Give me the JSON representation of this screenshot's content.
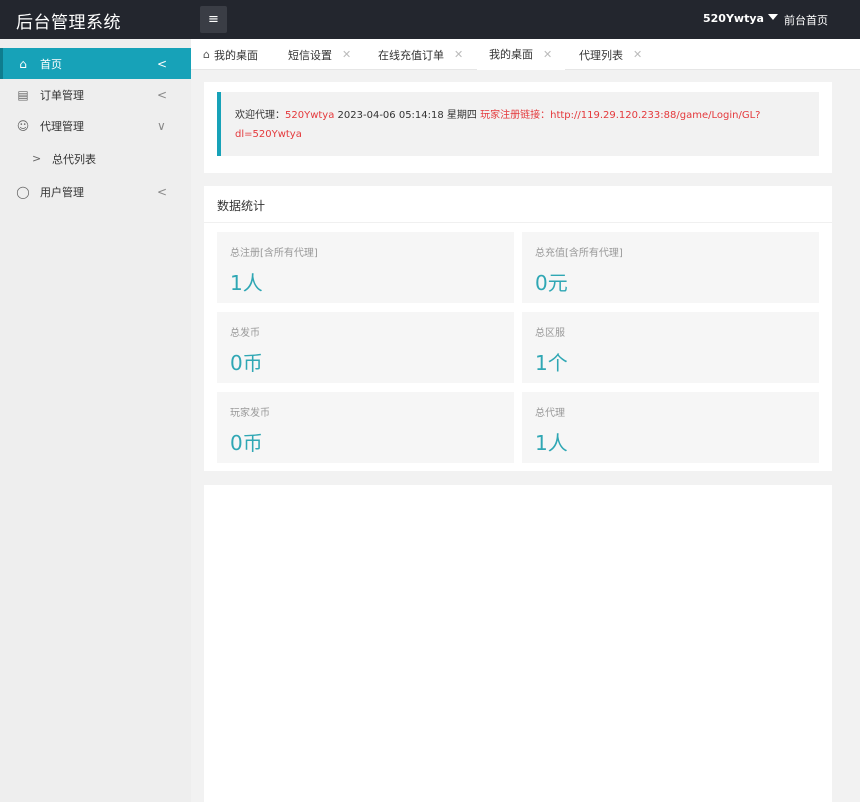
{
  "header": {
    "title": "后台管理系统",
    "menu_toggle_icon": "hamburger-icon",
    "user_name": "520Ywtya",
    "front_link": "前台首页"
  },
  "sidebar": {
    "items": [
      {
        "label": "首页",
        "icon": "home-icon",
        "arrow": "<",
        "active": true
      },
      {
        "label": "订单管理",
        "icon": "document-icon",
        "arrow": "<"
      },
      {
        "label": "代理管理",
        "icon": "agent-icon",
        "arrow": "∨"
      },
      {
        "label": "总代列表",
        "icon": "chevron-right-icon",
        "arrow": ">"
      },
      {
        "label": "用户管理",
        "icon": "user-icon",
        "arrow": "<"
      }
    ]
  },
  "tabs": [
    {
      "label": "我的桌面"
    },
    {
      "label": "短信设置"
    },
    {
      "label": "在线充值订单"
    },
    {
      "label": "我的桌面",
      "active": true
    },
    {
      "label": "代理列表"
    }
  ],
  "welcome": {
    "prefix": "欢迎代理：",
    "agent": "520Ywtya",
    "datetime": "2023-04-06  05:14:18  星期四",
    "link_label": "玩家注册链接：",
    "link_url_line1": "http://119.29.120.233:88/game/Login/GL?",
    "link_url_line2": "dl=520Ywtya"
  },
  "stats": {
    "title": "数据统计",
    "items": [
      {
        "label": "总注册[含所有代理]",
        "value": "1人"
      },
      {
        "label": "总充值[含所有代理]",
        "value": "0元"
      },
      {
        "label": "总发币",
        "value": "0币"
      },
      {
        "label": "总区服",
        "value": "1个"
      },
      {
        "label": "玩家发币",
        "value": "0币"
      },
      {
        "label": "总代理",
        "value": "1人"
      }
    ]
  },
  "colors": {
    "accent": "#17a2b8",
    "header_bg": "#23262e",
    "link_red": "#e4393c",
    "stat_value": "#2fa7b4"
  }
}
